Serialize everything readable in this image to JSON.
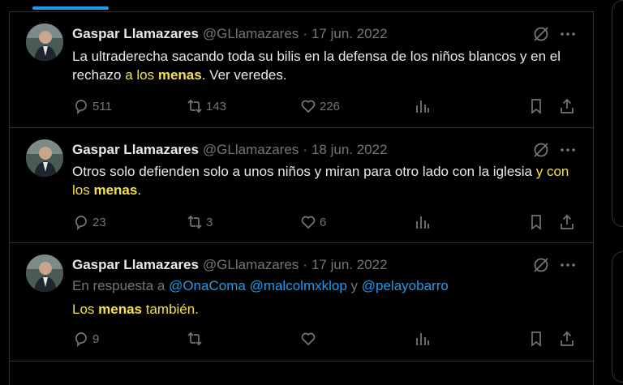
{
  "tweets": [
    {
      "name": "Gaspar Llamazares",
      "handle": "@GLlamazares",
      "separator": "·",
      "date": "17 jun. 2022",
      "text_before": "La ultraderecha sacando toda su bilis en la defensa de los niños blancos y en el rechazo ",
      "hl_a": "a los ",
      "hl_bold": "menas",
      "text_after": ". Ver veredes.",
      "replies": "511",
      "retweets": "143",
      "likes": "226"
    },
    {
      "name": "Gaspar Llamazares",
      "handle": "@GLlamazares",
      "separator": "·",
      "date": "18 jun. 2022",
      "text_before": "Otros solo defienden solo a unos niños y miran para otro lado con la iglesia ",
      "hl_a": "y con los ",
      "hl_bold": "menas",
      "text_after": ".",
      "replies": "23",
      "retweets": "3",
      "likes": "6"
    },
    {
      "name": "Gaspar Llamazares",
      "handle": "@GLlamazares",
      "separator": "·",
      "date": "17 jun. 2022",
      "reply_prefix": "En respuesta a ",
      "mentions": [
        "@OnaComa",
        "@malcolmxklop",
        "@pelayobarro"
      ],
      "reply_joiner": "y",
      "hl_a": "Los ",
      "hl_bold": "menas",
      "text_after": " también.",
      "replies": "9"
    }
  ],
  "colors": {
    "accent": "#1d9bf0",
    "highlight": "#f5e048",
    "muted": "#71767b",
    "text": "#e7e9ea"
  },
  "icons": [
    "grok-icon",
    "more-icon",
    "reply-icon",
    "retweet-icon",
    "like-icon",
    "views-icon",
    "bookmark-icon",
    "share-icon"
  ]
}
